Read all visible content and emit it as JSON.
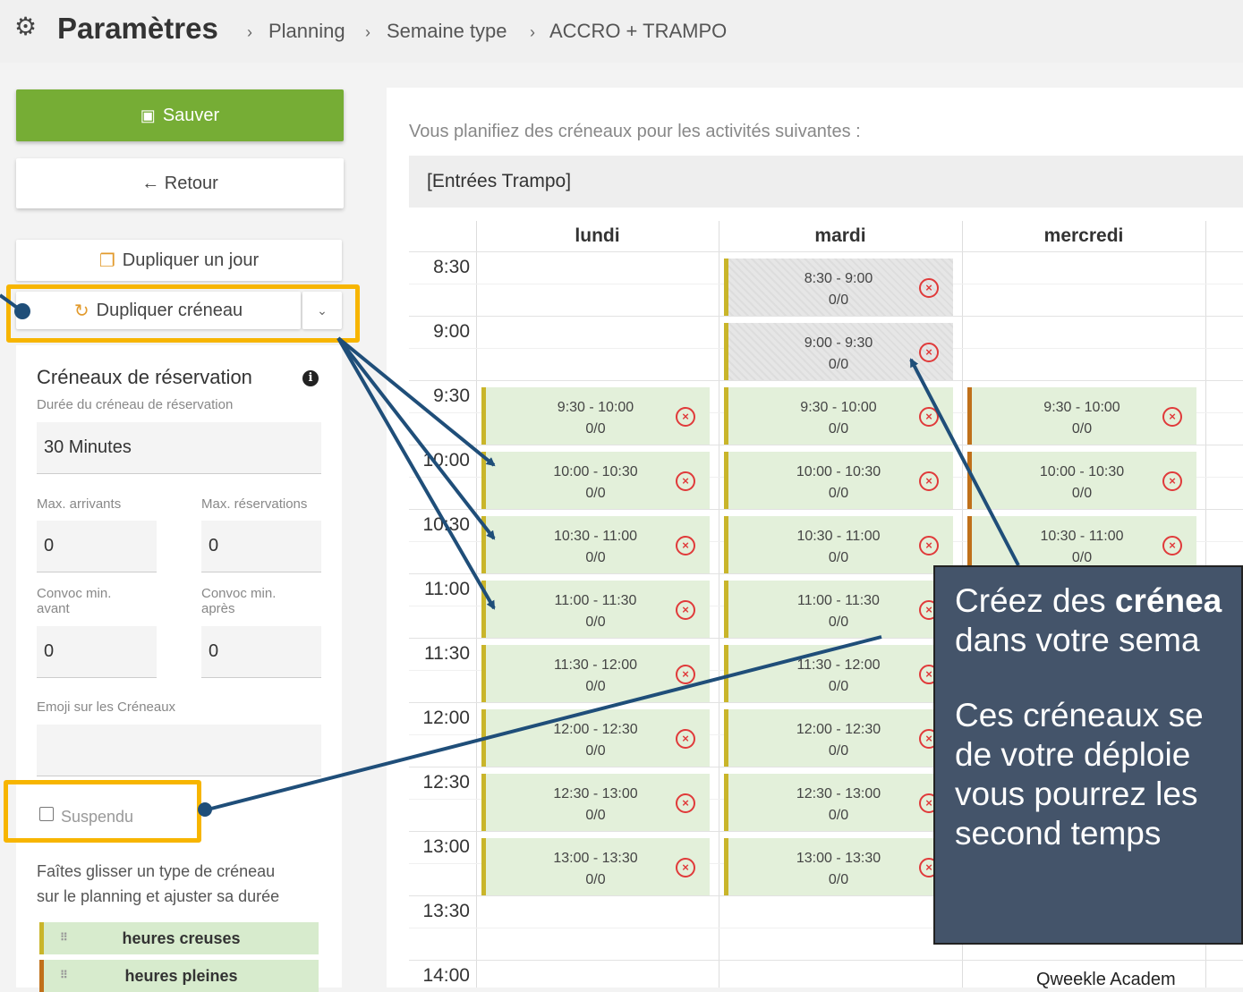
{
  "header": {
    "title": "Paramètres",
    "breadcrumbs": [
      "Planning",
      "Semaine type",
      "ACCRO + TRAMPO"
    ],
    "separator": "›"
  },
  "sidebar": {
    "save_label": "Sauver",
    "back_label": "← Retour",
    "duplicate_day_label": "Dupliquer un jour",
    "duplicate_slot_label": "Dupliquer créneau",
    "dropdown_caret": "⌄",
    "panel": {
      "title": "Créneaux de réservation",
      "duration_label": "Durée du créneau de réservation",
      "duration_value": "30 Minutes",
      "max_arrivals_label": "Max. arrivants",
      "max_arrivals_value": "0",
      "max_reservations_label": "Max. réservations",
      "max_reservations_value": "0",
      "convoc_before_label_1": "Convoc min.",
      "convoc_before_label_2": "avant",
      "convoc_before_value": "0",
      "convoc_after_label_1": "Convoc min.",
      "convoc_after_label_2": "après",
      "convoc_after_value": "0",
      "emoji_label": "Emoji sur les Créneaux",
      "emoji_value": "",
      "suspended_label": "Suspendu",
      "hint_line1": "Faîtes glisser un type de créneau",
      "hint_line2": "sur le planning et ajuster sa durée",
      "slot_types": [
        {
          "label": "heures creuses",
          "color": "#c9b52a"
        },
        {
          "label": "heures pleines",
          "color": "#c0701a"
        }
      ]
    }
  },
  "main": {
    "intro": "Vous planifiez des créneaux pour les activités suivantes :",
    "activity": "[Entrées Trampo]",
    "days": [
      "lundi",
      "mardi",
      "mercredi"
    ],
    "times": [
      "8:30",
      "9:00",
      "9:30",
      "10:00",
      "10:30",
      "11:00",
      "11:30",
      "12:00",
      "12:30",
      "13:00",
      "13:30",
      "14:00"
    ],
    "slots": {
      "lundi": [
        {
          "time": "9:30 - 10:00",
          "count": "0/0"
        },
        {
          "time": "10:00 - 10:30",
          "count": "0/0"
        },
        {
          "time": "10:30 - 11:00",
          "count": "0/0"
        },
        {
          "time": "11:00 - 11:30",
          "count": "0/0"
        },
        {
          "time": "11:30 - 12:00",
          "count": "0/0"
        },
        {
          "time": "12:00 - 12:30",
          "count": "0/0"
        },
        {
          "time": "12:30 - 13:00",
          "count": "0/0"
        },
        {
          "time": "13:00 - 13:30",
          "count": "0/0"
        }
      ],
      "mardi_grey": [
        {
          "time": "8:30 - 9:00",
          "count": "0/0"
        },
        {
          "time": "9:00 - 9:30",
          "count": "0/0"
        }
      ],
      "mardi": [
        {
          "time": "9:30 - 10:00",
          "count": "0/0"
        },
        {
          "time": "10:00 - 10:30",
          "count": "0/0"
        },
        {
          "time": "10:30 - 11:00",
          "count": "0/0"
        },
        {
          "time": "11:00 - 11:30",
          "count": "0/0"
        },
        {
          "time": "11:30 - 12:00",
          "count": "0/0"
        },
        {
          "time": "12:00 - 12:30",
          "count": "0/0"
        },
        {
          "time": "12:30 - 13:00",
          "count": "0/0"
        },
        {
          "time": "13:00 - 13:30",
          "count": "0/0"
        }
      ],
      "mercredi": [
        {
          "time": "9:30 - 10:00",
          "count": "0/0"
        },
        {
          "time": "10:00 - 10:30",
          "count": "0/0"
        },
        {
          "time": "10:30 - 11:00",
          "count": "0/0"
        }
      ]
    },
    "remove_glyph": "×"
  },
  "tooltip": {
    "line1_a": "Créez des ",
    "line1_b": "crénea",
    "line2": "dans votre sema",
    "line3": "Ces créneaux se",
    "line4": "de votre déploie",
    "line5": "vous pourrez les",
    "line6": "second temps"
  },
  "footer": "Qweekle Academ",
  "colors": {
    "save": "#76ad35",
    "highlight": "#f7b500",
    "tooltip_bg": "#44546a",
    "arrow": "#1f4e79",
    "slot_bg": "#e3f0da",
    "creuses": "#c9b52a",
    "pleines": "#c0701a",
    "remove": "#e03a3a"
  }
}
